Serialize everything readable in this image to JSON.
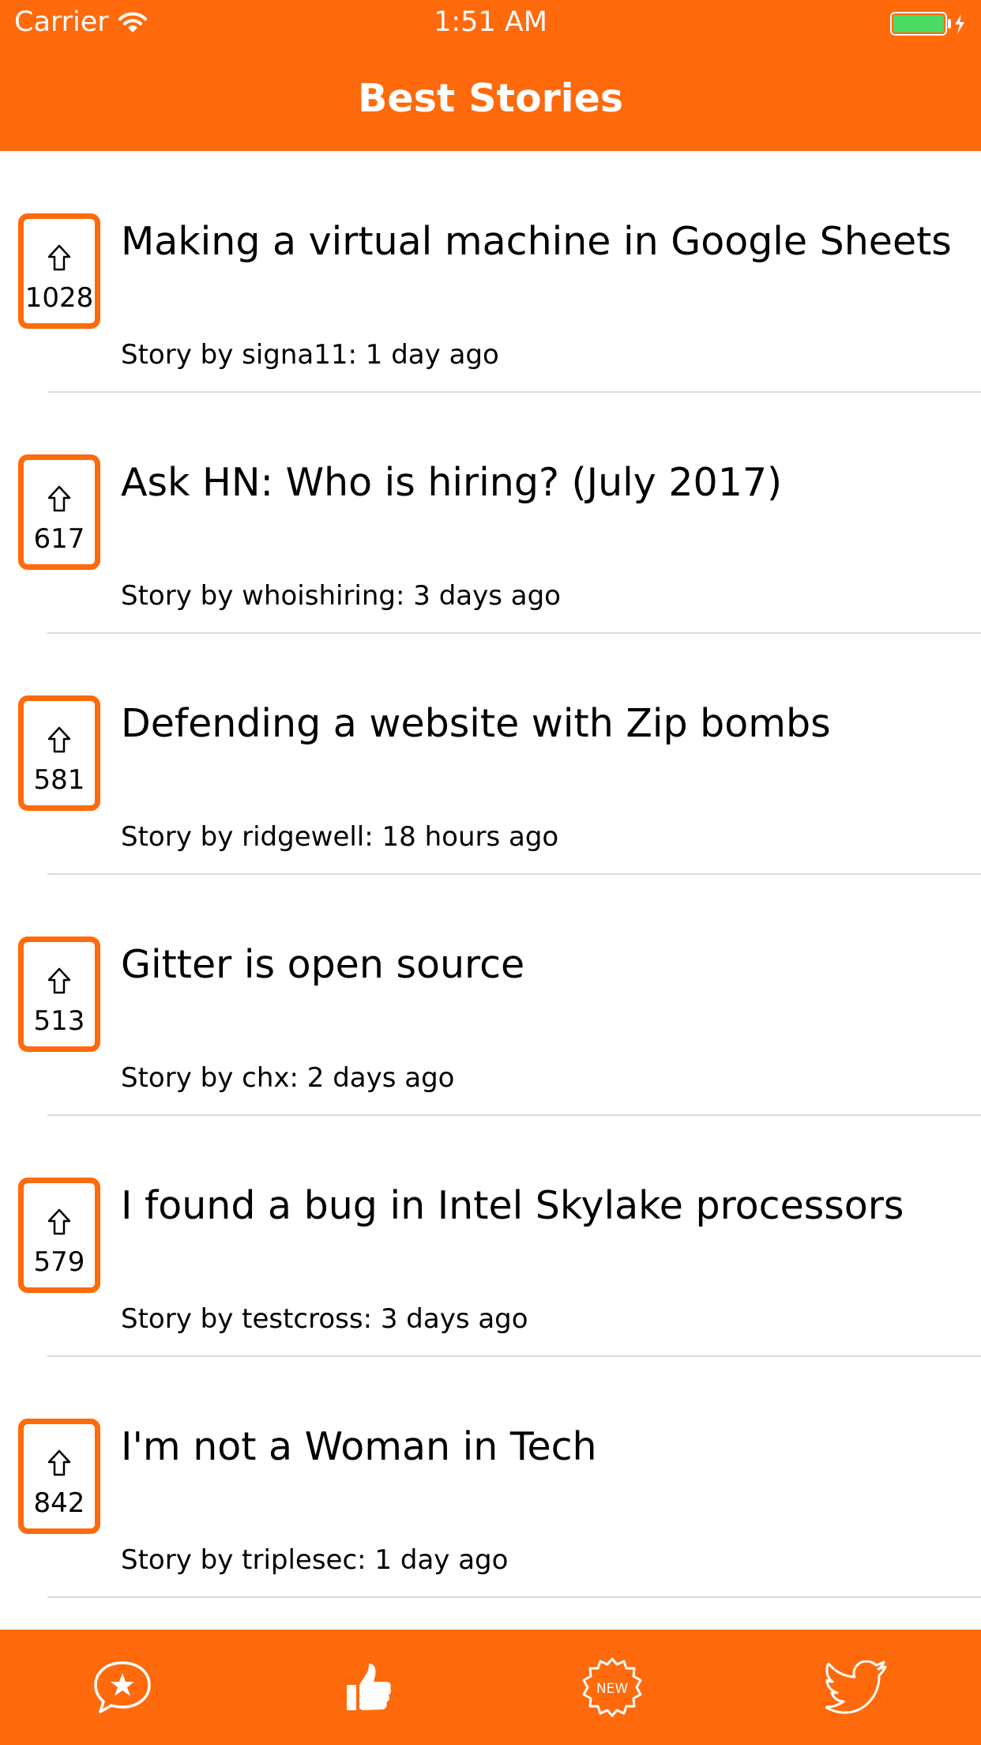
{
  "status_bar": {
    "carrier": "Carrier",
    "time": "1:51 AM"
  },
  "nav": {
    "title": "Best Stories"
  },
  "stories": [
    {
      "score": "1028",
      "title": "Making a virtual machine in Google Sheets",
      "meta": "Story by signa11: 1 day ago"
    },
    {
      "score": "617",
      "title": "Ask HN: Who is hiring? (July 2017)",
      "meta": "Story by whoishiring: 3 days ago"
    },
    {
      "score": "581",
      "title": "Defending a website with Zip bombs",
      "meta": "Story by ridgewell: 18 hours ago"
    },
    {
      "score": "513",
      "title": "Gitter is open source",
      "meta": "Story by chx: 2 days ago"
    },
    {
      "score": "579",
      "title": "I found a bug in Intel Skylake processors",
      "meta": "Story by testcross: 3 days ago"
    },
    {
      "score": "842",
      "title": "I'm not a Woman in Tech",
      "meta": "Story by triplesec: 1 day ago"
    }
  ],
  "tabbar": {
    "icons": [
      "star-chat-icon",
      "thumbs-up-icon",
      "new-badge-icon",
      "twitter-bird-icon"
    ],
    "new_badge_text": "NEW"
  },
  "colors": {
    "accent": "#fe6a0c",
    "separator": "#d9d9d9"
  }
}
